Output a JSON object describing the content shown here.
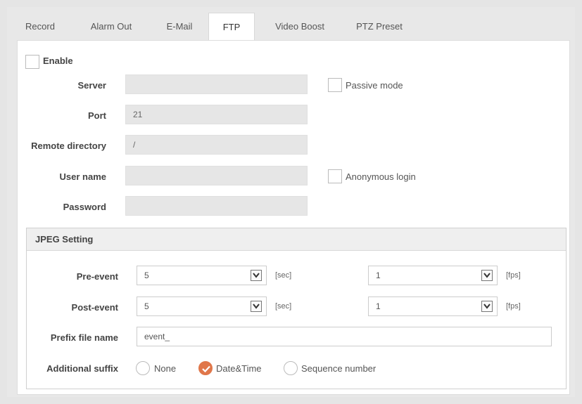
{
  "tabs": [
    "Record",
    "Alarm Out",
    "E-Mail",
    "FTP",
    "Video Boost",
    "PTZ Preset"
  ],
  "active_tab": "FTP",
  "enable": {
    "label": "Enable",
    "checked": false
  },
  "fields": {
    "server": {
      "label": "Server",
      "value": ""
    },
    "port": {
      "label": "Port",
      "value": "21"
    },
    "remote_directory": {
      "label": "Remote directory",
      "value": "/"
    },
    "user_name": {
      "label": "User name",
      "value": ""
    },
    "password": {
      "label": "Password",
      "value": ""
    }
  },
  "passive_mode": {
    "label": "Passive mode",
    "checked": false
  },
  "anonymous_login": {
    "label": "Anonymous login",
    "checked": false
  },
  "jpeg": {
    "title": "JPEG Setting",
    "pre_event": {
      "label": "Pre-event",
      "sec_value": "5",
      "sec_unit": "[sec]",
      "fps_value": "1",
      "fps_unit": "[fps]"
    },
    "post_event": {
      "label": "Post-event",
      "sec_value": "5",
      "sec_unit": "[sec]",
      "fps_value": "1",
      "fps_unit": "[fps]"
    },
    "prefix": {
      "label": "Prefix file name",
      "value": "event_"
    },
    "suffix": {
      "label": "Additional suffix",
      "options": [
        "None",
        "Date&Time",
        "Sequence number"
      ],
      "selected": "Date&Time"
    }
  },
  "colors": {
    "accent": "#e0774a"
  },
  "icons": {
    "dropdown": "chevron-down-icon",
    "radio_checked": "check-icon"
  }
}
